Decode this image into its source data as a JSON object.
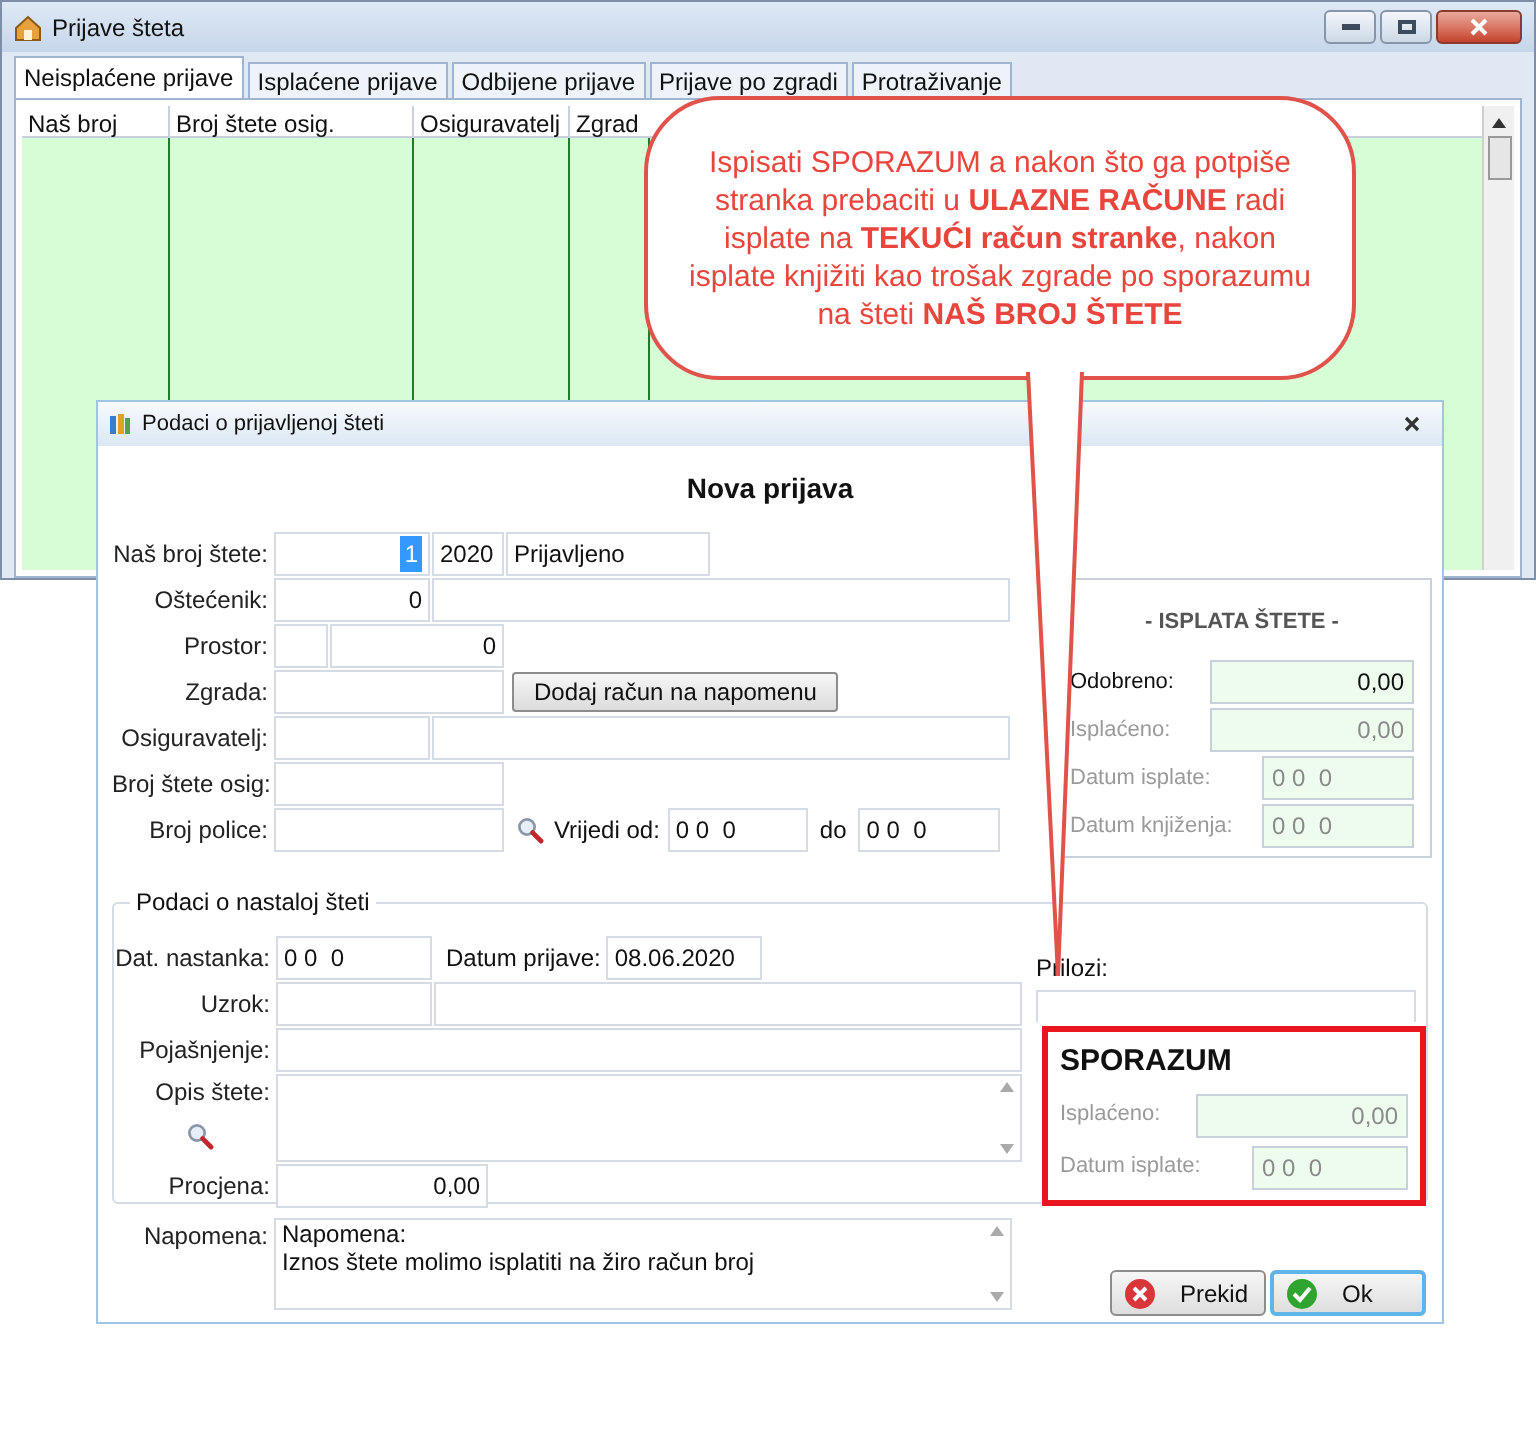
{
  "background_window": {
    "title": "Prijave šteta",
    "tabs": [
      {
        "label": "Neisplaćene prijave",
        "selected": true
      },
      {
        "label": "Isplaćene prijave",
        "selected": false
      },
      {
        "label": "Odbijene prijave",
        "selected": false
      },
      {
        "label": "Prijave po zgradi",
        "selected": false
      },
      {
        "label": "Protraživanje",
        "selected": false
      }
    ],
    "table": {
      "columns": [
        "Naš broj",
        "Broj štete osig.",
        "Osiguravatelj",
        "Zgrad"
      ]
    }
  },
  "callout": {
    "text": "Ispisati SPORAZUM a nakon što ga potpiše stranka prebaciti u **ULAZNE RAČUNE** radi isplate na **TEKUĆI račun stranke**, nakon isplate knjižiti kao trošak zgrade po sporazumu na šteti **NAŠ BROJ ŠTETE**"
  },
  "dialog": {
    "title": "Podaci o prijavljenoj šteti",
    "heading": "Nova prijava",
    "claim_rows": [
      {
        "label": "Naš broj štete:",
        "fields": [
          {
            "value": "1",
            "highlighted": true
          },
          {
            "value": "2020"
          },
          {
            "value": "Prijavljeno"
          }
        ]
      },
      {
        "label": "Oštećenik:",
        "fields": [
          {
            "value": "0"
          }
        ]
      },
      {
        "label": "Prostor:",
        "fields": [
          {
            "value": "0"
          }
        ]
      },
      {
        "label": "Zgrada:",
        "button": "Dodaj račun na napomenu"
      },
      {
        "label": "Osiguravatelj:"
      },
      {
        "label": "Broj štete osig:"
      },
      {
        "label": "Broj police:",
        "range": {
          "from_label": "Vrijedi od:",
          "from": "0 0  0",
          "to_label": "do",
          "to": "0 0  0"
        }
      }
    ],
    "payment": {
      "title": "- ISPLATA ŠTETE -",
      "rows": [
        {
          "label": "Odobreno:",
          "value": "0,00",
          "disabled": false
        },
        {
          "label": "Isplaćeno:",
          "value": "0,00",
          "disabled": true
        },
        {
          "label": "Datum isplate:",
          "value": "0 0  0",
          "disabled": true
        },
        {
          "label": "Datum knjiženja:",
          "value": "0 0  0",
          "disabled": true
        }
      ]
    },
    "incident": {
      "title": "Podaci o nastaloj šteti",
      "rows": [
        {
          "kind": "fields",
          "label": "Dat. nastanka:",
          "fields": [
            {
              "value": "0 0  0"
            }
          ],
          "second": {
            "label": "Datum prijave:",
            "value": "08.06.2020"
          }
        },
        {
          "kind": "fields",
          "label": "Uzrok:"
        },
        {
          "kind": "fields",
          "label": "Pojašnjenje:"
        },
        {
          "kind": "textarea",
          "label": "Opis štete:"
        },
        {
          "kind": "fields",
          "label": "Procjena:",
          "fields": [
            {
              "value": "0,00"
            }
          ]
        }
      ],
      "attachments_label": "Prilozi:"
    },
    "agreement": {
      "title": "SPORAZUM",
      "rows": [
        {
          "label": "Isplaćeno:",
          "value": "0,00",
          "disabled": true
        },
        {
          "label": "Datum isplate:",
          "value": "0 0  0",
          "disabled": true
        }
      ]
    },
    "note": {
      "label": "Napomena:",
      "lines": [
        "Napomena:",
        "Iznos štete molimo isplatiti na žiro račun broj"
      ]
    },
    "buttons": [
      {
        "label": "Prekid",
        "kind": "cancel",
        "default": false
      },
      {
        "label": "Ok",
        "kind": "ok",
        "default": true
      }
    ]
  }
}
